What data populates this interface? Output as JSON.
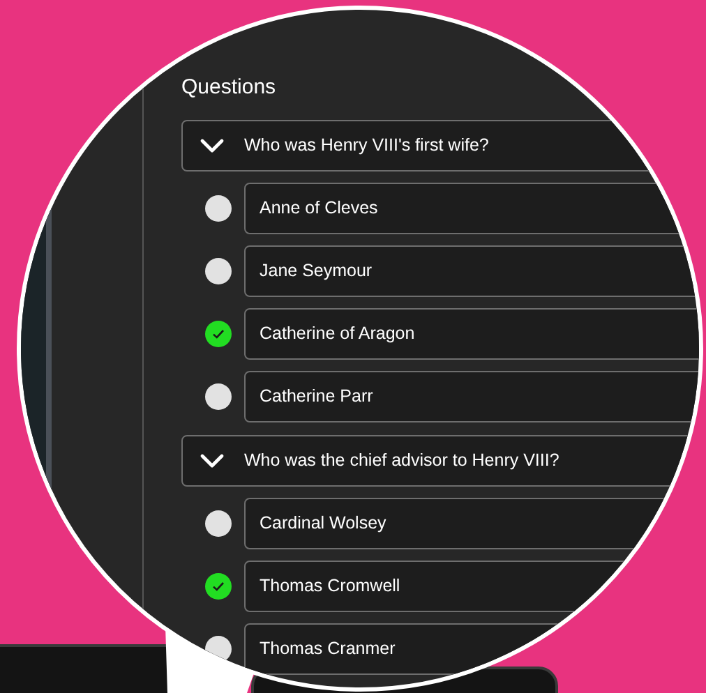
{
  "section_title": "Questions",
  "questions": [
    {
      "text": "Who was Henry VIII's first wife?",
      "expanded": true,
      "answers": [
        {
          "text": "Anne of Cleves",
          "correct": false
        },
        {
          "text": "Jane Seymour",
          "correct": false
        },
        {
          "text": "Catherine of Aragon",
          "correct": true
        },
        {
          "text": "Catherine Parr",
          "correct": false
        }
      ]
    },
    {
      "text": "Who was the chief advisor to Henry VIII?",
      "expanded": true,
      "answers": [
        {
          "text": "Cardinal Wolsey",
          "correct": false
        },
        {
          "text": "Thomas Cromwell",
          "correct": true
        },
        {
          "text": "Thomas Cranmer",
          "correct": false
        }
      ]
    }
  ]
}
